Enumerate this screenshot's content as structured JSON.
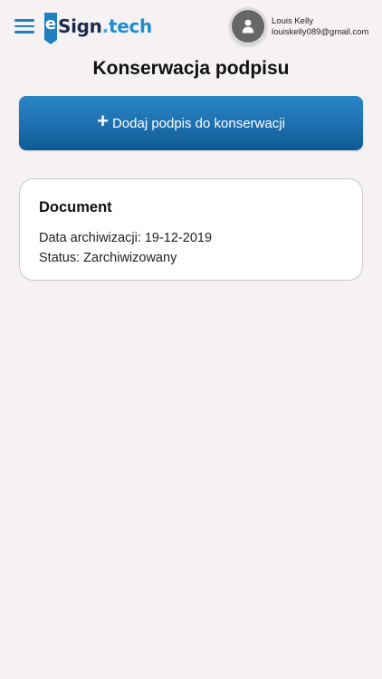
{
  "header": {
    "logo": {
      "e": "e",
      "brand": "Sign",
      "dot": ".",
      "tld": "tech"
    },
    "user": {
      "name": "Louis Kelly",
      "email": "louiskelly089@gmail.com"
    },
    "icons": {
      "menu": "hamburger-menu-icon",
      "avatar": "user-icon"
    }
  },
  "page": {
    "title": "Konserwacja podpisu"
  },
  "add_button": {
    "icon": "+",
    "label": "Dodaj podpis do konserwacji"
  },
  "documents": [
    {
      "title": "Document",
      "archive_label": "Data archiwizacji: ",
      "archive_date": "19-12-2019",
      "status_label": "Status: ",
      "status": "Zarchiwizowany"
    }
  ],
  "colors": {
    "accent": "#1f7fbf",
    "background": "#f6f2f3",
    "button_top": "#2a86c6",
    "button_bottom": "#0f5a93"
  }
}
